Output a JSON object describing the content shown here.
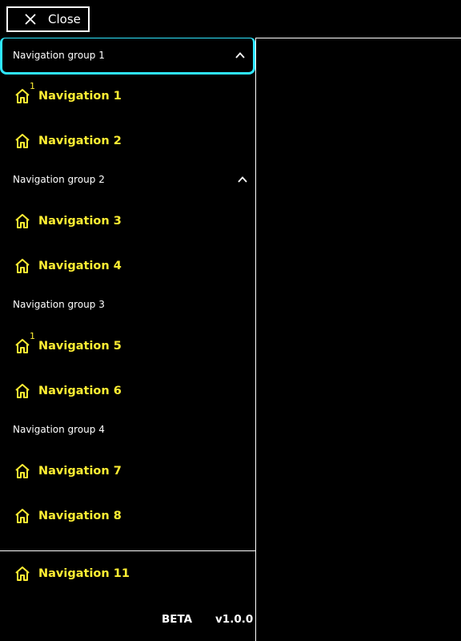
{
  "close_button": {
    "label": "Close"
  },
  "colors": {
    "accent_text": "#ffee33",
    "focus_ring": "#2ee6ff",
    "foreground": "#ffffff",
    "background": "#000000"
  },
  "nav": {
    "groups": [
      {
        "label": "Navigation group 1",
        "expanded": true,
        "focused": true
      },
      {
        "label": "Navigation group 2",
        "expanded": true,
        "focused": false
      },
      {
        "label": "Navigation group 3"
      },
      {
        "label": "Navigation group 4"
      }
    ],
    "items": [
      {
        "label": "Navigation 1",
        "icon": "home-icon",
        "badge": "1"
      },
      {
        "label": "Navigation 2",
        "icon": "home-icon"
      },
      {
        "label": "Navigation 3",
        "icon": "home-icon"
      },
      {
        "label": "Navigation 4",
        "icon": "home-icon"
      },
      {
        "label": "Navigation 5",
        "icon": "home-icon",
        "badge": "1"
      },
      {
        "label": "Navigation 6",
        "icon": "home-icon"
      },
      {
        "label": "Navigation 7",
        "icon": "home-icon"
      },
      {
        "label": "Navigation 8",
        "icon": "home-icon"
      }
    ],
    "footer_item": {
      "label": "Navigation 11",
      "icon": "home-icon"
    }
  },
  "footer": {
    "beta": "BETA",
    "version": "v1.0.0"
  }
}
